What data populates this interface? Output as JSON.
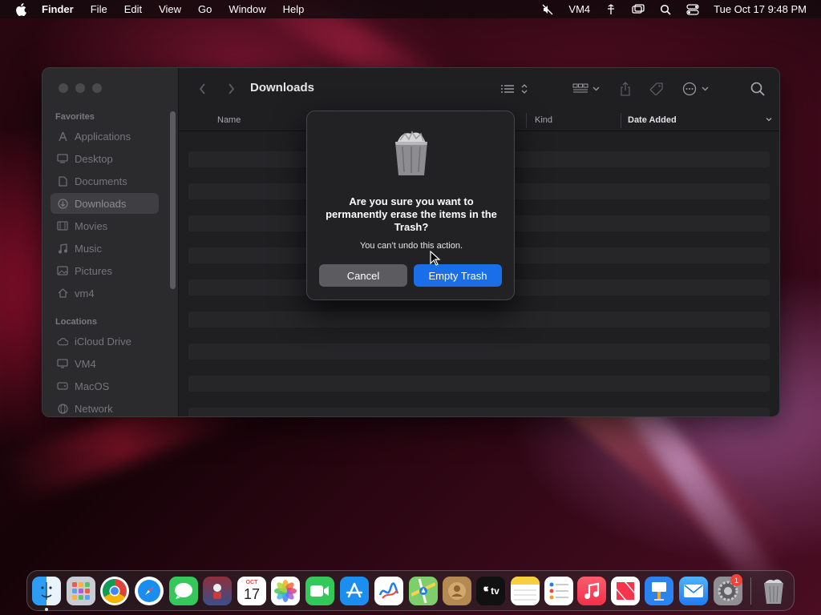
{
  "menubar": {
    "app_name": "Finder",
    "menus": [
      "File",
      "Edit",
      "View",
      "Go",
      "Window",
      "Help"
    ],
    "status": {
      "mute_icon": "speaker-muted-icon",
      "vm_label": "VM4",
      "datetime": "Tue Oct 17  9:48 PM"
    }
  },
  "window": {
    "title": "Downloads",
    "sidebar": {
      "favorites_heading": "Favorites",
      "favorites": [
        {
          "label": "Applications",
          "icon": "applications-icon"
        },
        {
          "label": "Desktop",
          "icon": "desktop-icon"
        },
        {
          "label": "Documents",
          "icon": "document-icon"
        },
        {
          "label": "Downloads",
          "icon": "downloads-icon",
          "selected": true
        },
        {
          "label": "Movies",
          "icon": "movies-icon"
        },
        {
          "label": "Music",
          "icon": "music-icon"
        },
        {
          "label": "Pictures",
          "icon": "pictures-icon"
        },
        {
          "label": "vm4",
          "icon": "home-icon"
        }
      ],
      "locations_heading": "Locations",
      "locations": [
        {
          "label": "iCloud Drive",
          "icon": "cloud-icon"
        },
        {
          "label": "VM4",
          "icon": "display-icon"
        },
        {
          "label": "MacOS",
          "icon": "disk-icon"
        },
        {
          "label": "Network",
          "icon": "network-icon"
        }
      ]
    },
    "columns": {
      "name": "Name",
      "kind": "Kind",
      "date_added": "Date Added"
    }
  },
  "dialog": {
    "title": "Are you sure you want to permanently erase the items in the Trash?",
    "message": "You can’t undo this action.",
    "cancel_label": "Cancel",
    "confirm_label": "Empty Trash",
    "accent_color": "#1a6fe8"
  },
  "dock": {
    "apps": [
      "Finder",
      "Launchpad",
      "Google Chrome",
      "Safari",
      "Messages",
      "Maps Game",
      "Calendar",
      "Photos",
      "FaceTime",
      "App Store",
      "Freeform",
      "Maps",
      "Contacts",
      "TV",
      "Notes",
      "Reminders",
      "Music",
      "News",
      "Keynote",
      "Mail",
      "System Settings",
      "Trash"
    ],
    "calendar_month": "OCT",
    "calendar_day": "17",
    "tv_label": "tv",
    "settings_badge": "1"
  }
}
